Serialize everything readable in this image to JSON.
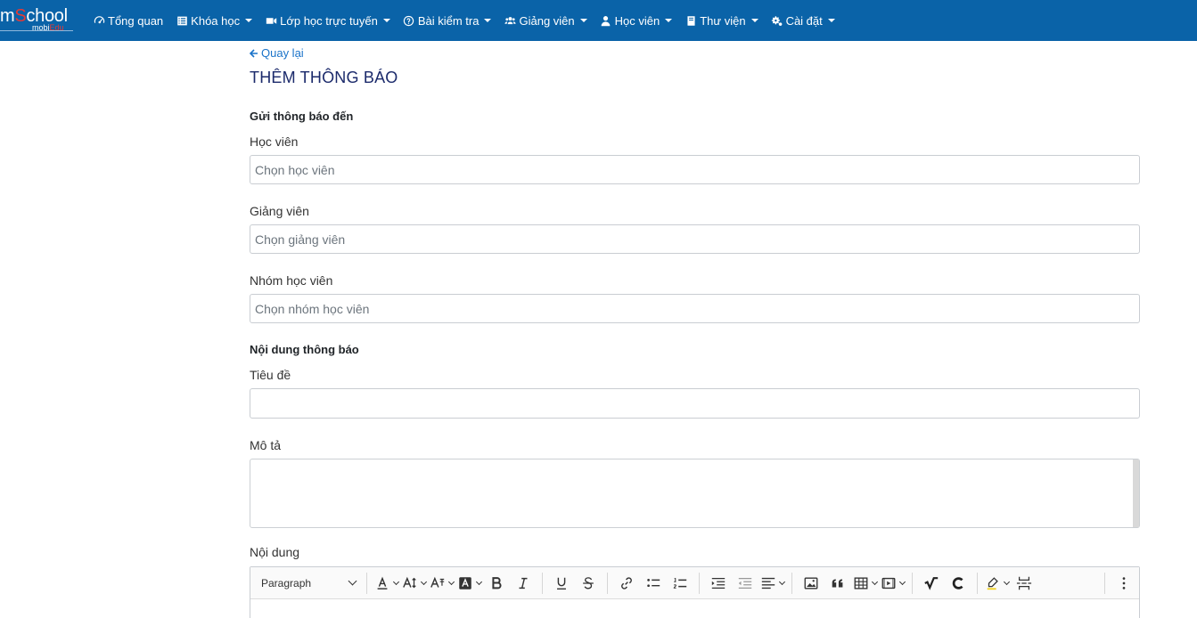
{
  "app": {
    "logo_text_1": "m",
    "logo_text_accent": "S",
    "logo_text_2": "chool",
    "logo_sub_1": "mobi",
    "logo_sub_accent": "Edu"
  },
  "nav": {
    "items": [
      {
        "label": "Tổng quan",
        "icon": "dashboard-icon",
        "dropdown": false
      },
      {
        "label": "Khóa học",
        "icon": "list-icon",
        "dropdown": true
      },
      {
        "label": "Lớp học trực tuyến",
        "icon": "video-icon",
        "dropdown": true
      },
      {
        "label": "Bài kiểm tra",
        "icon": "question-circle-icon",
        "dropdown": true
      },
      {
        "label": "Giảng viên",
        "icon": "users-icon",
        "dropdown": true
      },
      {
        "label": "Học viên",
        "icon": "user-icon",
        "dropdown": true
      },
      {
        "label": "Thư viện",
        "icon": "book-icon",
        "dropdown": true
      },
      {
        "label": "Cài đặt",
        "icon": "cogs-icon",
        "dropdown": true
      }
    ]
  },
  "page": {
    "back_label": "Quay lại",
    "title": "THÊM THÔNG BÁO"
  },
  "recipients": {
    "section_title": "Gửi thông báo đến",
    "student_label": "Học viên",
    "student_placeholder": "Chọn học viên",
    "teacher_label": "Giảng viên",
    "teacher_placeholder": "Chọn giảng viên",
    "group_label": "Nhóm học viên",
    "group_placeholder": "Chọn nhóm học viên"
  },
  "content": {
    "section_title": "Nội dung thông báo",
    "title_label": "Tiêu đề",
    "title_value": "",
    "description_label": "Mô tả",
    "description_value": "",
    "body_label": "Nội dung"
  },
  "editor": {
    "paragraph_select": "Paragraph"
  },
  "colors": {
    "navbar": "#0a63a8",
    "accent": "#e53935",
    "link": "#1a73c9",
    "title": "#1b2a6b"
  }
}
